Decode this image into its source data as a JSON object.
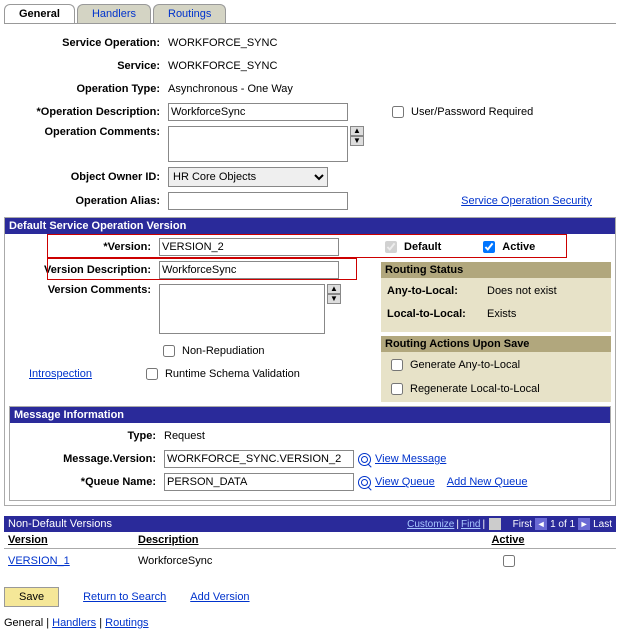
{
  "tabs": {
    "general": "General",
    "handlers": "Handlers",
    "routings": "Routings"
  },
  "form": {
    "serviceOperation": {
      "label": "Service Operation:",
      "value": "WORKFORCE_SYNC"
    },
    "service": {
      "label": "Service:",
      "value": "WORKFORCE_SYNC"
    },
    "operationType": {
      "label": "Operation Type:",
      "value": "Asynchronous - One Way"
    },
    "operationDescription": {
      "label": "*Operation Description:",
      "value": "WorkforceSync"
    },
    "userPwdRequired": {
      "label": "User/Password Required"
    },
    "operationComments": {
      "label": "Operation Comments:",
      "value": ""
    },
    "objectOwnerId": {
      "label": "Object Owner ID:",
      "value": "HR Core Objects"
    },
    "operationAlias": {
      "label": "Operation Alias:",
      "value": ""
    },
    "securityLink": "Service Operation Security"
  },
  "versionSection": {
    "header": "Default Service Operation Version",
    "version": {
      "label": "*Version:",
      "value": "VERSION_2"
    },
    "default": {
      "label": "Default"
    },
    "active": {
      "label": "Active"
    },
    "versionDescription": {
      "label": "Version Description:",
      "value": "WorkforceSync"
    },
    "versionComments": {
      "label": "Version Comments:",
      "value": ""
    },
    "nonRepudiation": "Non-Repudiation",
    "runtimeSchema": "Runtime Schema Validation",
    "introspection": "Introspection",
    "routingStatus": {
      "header": "Routing Status",
      "anyToLocal": {
        "label": "Any-to-Local:",
        "value": "Does not exist"
      },
      "localToLocal": {
        "label": "Local-to-Local:",
        "value": "Exists"
      }
    },
    "routingActions": {
      "header": "Routing Actions Upon Save",
      "genAnyToLocal": "Generate Any-to-Local",
      "regenLocalToLocal": "Regenerate Local-to-Local"
    }
  },
  "messageInfo": {
    "header": "Message Information",
    "type": {
      "label": "Type:",
      "value": "Request"
    },
    "messageVersion": {
      "label": "Message.Version:",
      "value": "WORKFORCE_SYNC.VERSION_2",
      "link": "View Message"
    },
    "queueName": {
      "label": "*Queue Name:",
      "value": "PERSON_DATA",
      "link": "View Queue",
      "addLink": "Add New Queue"
    }
  },
  "nonDefault": {
    "header": "Non-Default Versions",
    "customize": "Customize",
    "find": "Find",
    "navFirst": "First",
    "navRange": "1 of 1",
    "navLast": "Last",
    "cols": {
      "version": "Version",
      "description": "Description",
      "active": "Active"
    },
    "rows": [
      {
        "version": "VERSION_1",
        "description": "WorkforceSync",
        "active": false
      }
    ]
  },
  "buttons": {
    "save": "Save",
    "returnSearch": "Return to Search",
    "addVersion": "Add Version"
  },
  "footer": {
    "general": "General",
    "handlers": "Handlers",
    "routings": "Routings"
  }
}
